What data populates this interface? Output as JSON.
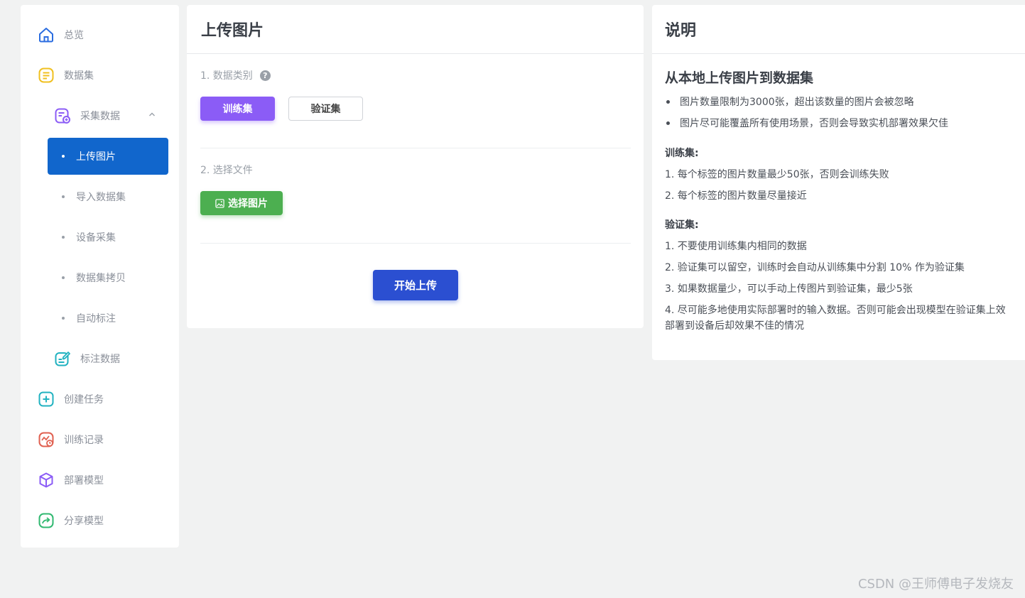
{
  "sidebar": {
    "items": [
      {
        "label": "总览",
        "icon": "home-icon",
        "color": "#2b6de0"
      },
      {
        "label": "数据集",
        "icon": "dataset-icon",
        "color": "#f0c020"
      },
      {
        "label": "采集数据",
        "icon": "collect-data-icon",
        "color": "#8b5cf6",
        "expanded": true
      },
      {
        "label": "标注数据",
        "icon": "annotate-icon",
        "color": "#20b2c0"
      },
      {
        "label": "创建任务",
        "icon": "add-task-icon",
        "color": "#20b2c0"
      },
      {
        "label": "训练记录",
        "icon": "train-record-icon",
        "color": "#e06050"
      },
      {
        "label": "部署模型",
        "icon": "cube-icon",
        "color": "#8b5cf6"
      },
      {
        "label": "分享模型",
        "icon": "share-icon",
        "color": "#30b870"
      }
    ],
    "sub_items": [
      {
        "label": "上传图片",
        "active": true
      },
      {
        "label": "导入数据集",
        "active": false
      },
      {
        "label": "设备采集",
        "active": false
      },
      {
        "label": "数据集拷贝",
        "active": false
      },
      {
        "label": "自动标注",
        "active": false
      }
    ]
  },
  "upload": {
    "title": "上传图片",
    "step1_label": "1. 数据类别",
    "help_glyph": "?",
    "train_button": "训练集",
    "val_button": "验证集",
    "step2_label": "2. 选择文件",
    "choose_button": "选择图片",
    "start_button": "开始上传"
  },
  "info": {
    "title": "说明",
    "heading": "从本地上传图片到数据集",
    "bullets": [
      "图片数量限制为3000张，超出该数量的图片会被忽略",
      "图片尽可能覆盖所有使用场景，否则会导致实机部署效果欠佳"
    ],
    "train_heading": "训练集:",
    "train_lines": [
      "1. 每个标签的图片数量最少50张，否则会训练失败",
      "2. 每个标签的图片数量尽量接近"
    ],
    "val_heading": "验证集:",
    "val_lines": [
      "1. 不要使用训练集内相同的数据",
      "2. 验证集可以留空，训练时会自动从训练集中分割 10% 作为验证集",
      "3. 如果数据量少，可以手动上传图片到验证集，最少5张",
      "4. 尽可能多地使用实际部署时的输入数据。否则可能会出现模型在验证集上效",
      "部署到设备后却效果不佳的情况"
    ]
  },
  "watermark": "CSDN @王师傅电子发烧友"
}
